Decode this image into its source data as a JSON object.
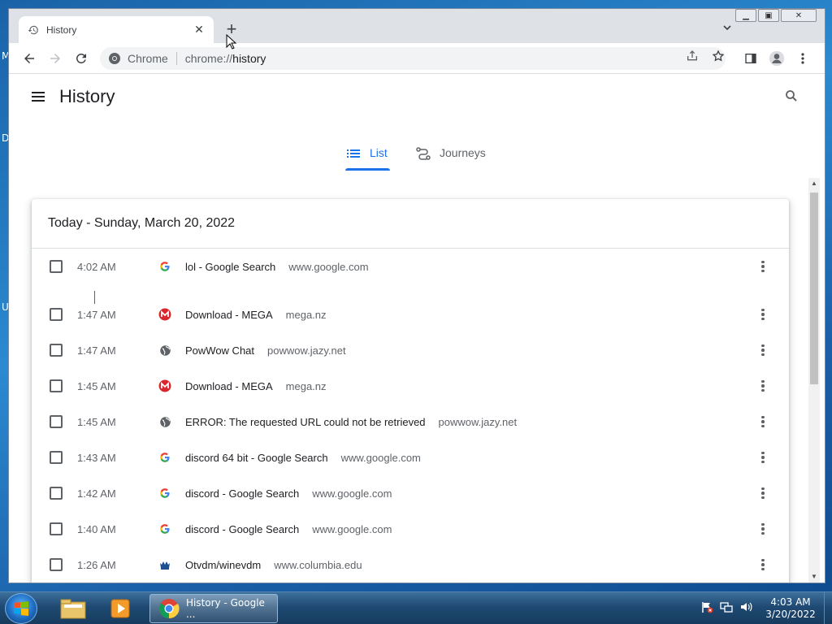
{
  "desktop": {
    "edge_letters": [
      "M",
      "D",
      "U"
    ]
  },
  "browser": {
    "tab": {
      "title": "History"
    },
    "omnibox": {
      "site_name": "Chrome",
      "url_scheme": "chrome://",
      "url_path": "history"
    }
  },
  "page": {
    "title": "History",
    "tabs": [
      {
        "label": "List",
        "icon": "list-icon",
        "active": true
      },
      {
        "label": "Journeys",
        "icon": "journeys-icon",
        "active": false
      }
    ],
    "day_header": "Today - Sunday, March 20, 2022",
    "entries": [
      {
        "time": "4:02 AM",
        "favicon": "google-icon",
        "title": "lol - Google Search",
        "domain": "www.google.com"
      },
      {
        "time": "1:47 AM",
        "favicon": "mega-icon",
        "title": "Download - MEGA",
        "domain": "mega.nz"
      },
      {
        "time": "1:47 AM",
        "favicon": "globe-icon",
        "title": "PowWow Chat",
        "domain": "powwow.jazy.net"
      },
      {
        "time": "1:45 AM",
        "favicon": "mega-icon",
        "title": "Download - MEGA",
        "domain": "mega.nz"
      },
      {
        "time": "1:45 AM",
        "favicon": "globe-icon",
        "title": "ERROR: The requested URL could not be retrieved",
        "domain": "powwow.jazy.net"
      },
      {
        "time": "1:43 AM",
        "favicon": "google-icon",
        "title": "discord 64 bit - Google Search",
        "domain": "www.google.com"
      },
      {
        "time": "1:42 AM",
        "favicon": "google-icon",
        "title": "discord - Google Search",
        "domain": "www.google.com"
      },
      {
        "time": "1:40 AM",
        "favicon": "google-icon",
        "title": "discord - Google Search",
        "domain": "www.google.com"
      },
      {
        "time": "1:26 AM",
        "favicon": "columbia-icon",
        "title": "Otvdm/winevdm",
        "domain": "www.columbia.edu"
      }
    ]
  },
  "taskbar": {
    "active_app_label": "History - Google ...",
    "clock_time": "4:03 AM",
    "clock_date": "3/20/2022"
  },
  "colors": {
    "accent": "#1a73e8",
    "mega_red": "#d9272e",
    "text_primary": "#202124",
    "text_secondary": "#5f6368"
  }
}
